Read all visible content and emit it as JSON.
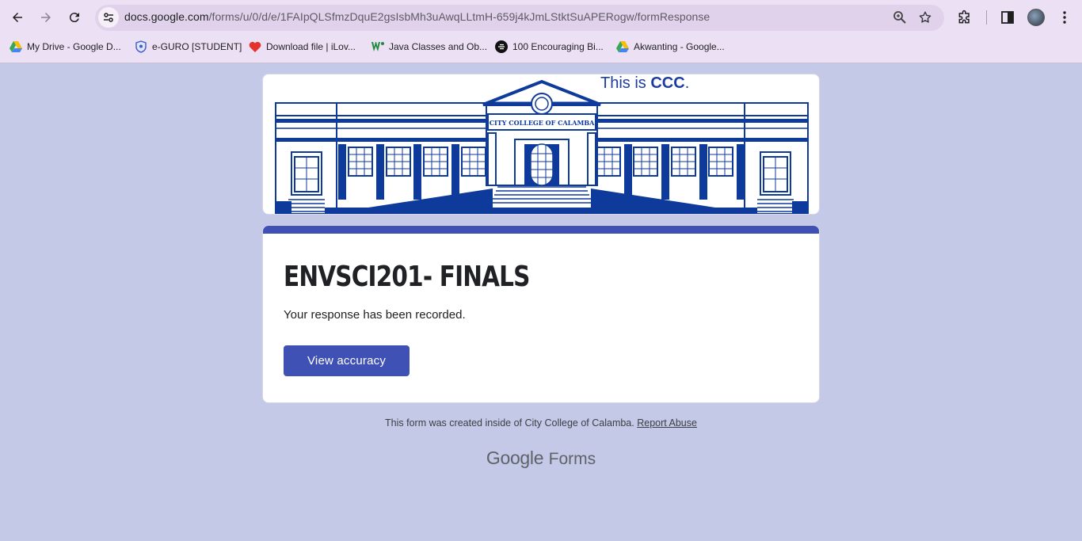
{
  "browser": {
    "url_host": "docs.google.com",
    "url_path": "/forms/u/0/d/e/1FAIpQLSfmzDquE2gsIsbMh3uAwqLLtmH-659j4kJmLStktSuAPERogw/formResponse",
    "bookmarks": [
      {
        "label": "My Drive - Google D...",
        "icon": "google-drive-icon"
      },
      {
        "label": "e-GURO [STUDENT]",
        "icon": "shield-icon"
      },
      {
        "label": "Download file | iLov...",
        "icon": "heart-icon"
      },
      {
        "label": "Java Classes and Ob...",
        "icon": "w-icon"
      },
      {
        "label": "100 Encouraging Bi...",
        "icon": "circle-logo-icon"
      },
      {
        "label": "Akwanting - Google...",
        "icon": "google-drive-icon"
      }
    ]
  },
  "header": {
    "tagline_prefix": "This is ",
    "tagline_bold": "CCC",
    "tagline_suffix": ".",
    "building_sign": "CITY COLLEGE OF CALAMBA"
  },
  "form": {
    "title": "ENVSCI201- FINALS",
    "confirmation": "Your response has been recorded.",
    "view_button": "View accuracy",
    "accent_color": "#3f51b5"
  },
  "footer": {
    "created_text": "This form was created inside of City College of Calamba.",
    "report_link": "Report Abuse",
    "brand_google": "Google",
    "brand_forms": "Forms"
  }
}
